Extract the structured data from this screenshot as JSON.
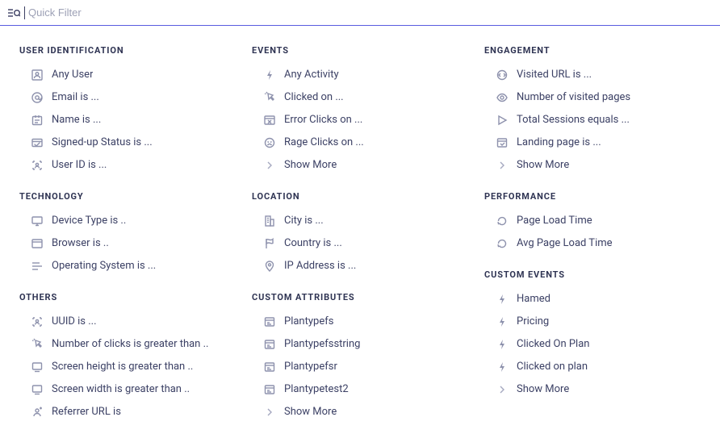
{
  "search": {
    "placeholder": "Quick Filter"
  },
  "columns": [
    {
      "sections": [
        {
          "title": "USER IDENTIFICATION",
          "items": [
            {
              "icon": "user-any",
              "label": "Any User"
            },
            {
              "icon": "at",
              "label": "Email is ..."
            },
            {
              "icon": "badge",
              "label": "Name is ..."
            },
            {
              "icon": "signup",
              "label": "Signed-up Status is ..."
            },
            {
              "icon": "userid",
              "label": "User ID is ..."
            }
          ]
        },
        {
          "title": "TECHNOLOGY",
          "items": [
            {
              "icon": "monitor",
              "label": "Device Type is .."
            },
            {
              "icon": "browser",
              "label": "Browser is .."
            },
            {
              "icon": "os",
              "label": "Operating System is ..."
            }
          ]
        },
        {
          "title": "OTHERS",
          "items": [
            {
              "icon": "userid",
              "label": "UUID is ..."
            },
            {
              "icon": "click",
              "label": "Number of clicks is greater than .."
            },
            {
              "icon": "screen",
              "label": "Screen height is greater than .."
            },
            {
              "icon": "screen",
              "label": "Screen width is greater than .."
            },
            {
              "icon": "referrer",
              "label": "Referrer URL is"
            }
          ]
        }
      ]
    },
    {
      "sections": [
        {
          "title": "EVENTS",
          "items": [
            {
              "icon": "bolt",
              "label": "Any Activity"
            },
            {
              "icon": "click",
              "label": "Clicked on ..."
            },
            {
              "icon": "errorclick",
              "label": "Error Clicks on ..."
            },
            {
              "icon": "rageclick",
              "label": "Rage Clicks on ..."
            },
            {
              "icon": "chevron",
              "label": "Show More",
              "showmore": true
            }
          ]
        },
        {
          "title": "LOCATION",
          "items": [
            {
              "icon": "building",
              "label": "City is ..."
            },
            {
              "icon": "flag",
              "label": "Country is ..."
            },
            {
              "icon": "pin",
              "label": "IP Address is ..."
            }
          ]
        },
        {
          "title": "CUSTOM ATTRIBUTES",
          "items": [
            {
              "icon": "card",
              "label": "Plantypefs"
            },
            {
              "icon": "card",
              "label": "Plantypefsstring"
            },
            {
              "icon": "card",
              "label": "Plantypefsr"
            },
            {
              "icon": "card",
              "label": "Plantypetest2"
            },
            {
              "icon": "chevron",
              "label": "Show More",
              "showmore": true
            }
          ]
        }
      ]
    },
    {
      "sections": [
        {
          "title": "ENGAGEMENT",
          "items": [
            {
              "icon": "urlring",
              "label": "Visited URL is ..."
            },
            {
              "icon": "eye",
              "label": "Number of visited pages"
            },
            {
              "icon": "play",
              "label": "Total Sessions equals ..."
            },
            {
              "icon": "landing",
              "label": "Landing page is ..."
            },
            {
              "icon": "chevron",
              "label": "Show More",
              "showmore": true
            }
          ]
        },
        {
          "title": "PERFORMANCE",
          "items": [
            {
              "icon": "refresh",
              "label": "Page Load Time"
            },
            {
              "icon": "refresh",
              "label": "Avg Page Load Time"
            }
          ]
        },
        {
          "title": "CUSTOM EVENTS",
          "items": [
            {
              "icon": "bolt",
              "label": "Hamed"
            },
            {
              "icon": "bolt",
              "label": "Pricing"
            },
            {
              "icon": "bolt",
              "label": "Clicked On Plan"
            },
            {
              "icon": "bolt",
              "label": "Clicked on plan"
            },
            {
              "icon": "chevron",
              "label": "Show More",
              "showmore": true
            }
          ]
        }
      ]
    }
  ]
}
